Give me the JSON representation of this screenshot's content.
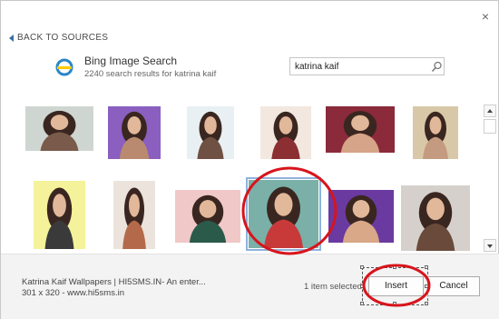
{
  "dialog": {
    "close_glyph": "×",
    "back_label": "BACK TO SOURCES",
    "source": {
      "name": "Bing Image Search",
      "results_text": "2240 search results for katrina kaif"
    },
    "search": {
      "value": "katrina kaif",
      "icon": "magnifier-icon"
    }
  },
  "thumbnails": [
    {
      "row": 1,
      "col": 1,
      "selected": false,
      "bg": "#cfd6d2",
      "tone": "#7a5a4a"
    },
    {
      "row": 1,
      "col": 2,
      "selected": false,
      "bg": "#8a5fc0",
      "tone": "#b98a70"
    },
    {
      "row": 1,
      "col": 3,
      "selected": false,
      "bg": "#e9f0f3",
      "tone": "#6f5143"
    },
    {
      "row": 1,
      "col": 4,
      "selected": false,
      "bg": "#f2e8e0",
      "tone": "#8c2f33"
    },
    {
      "row": 1,
      "col": 5,
      "selected": false,
      "bg": "#8a2a3a",
      "tone": "#d6a488"
    },
    {
      "row": 1,
      "col": 6,
      "selected": false,
      "bg": "#d8c8a8",
      "tone": "#c49a80"
    },
    {
      "row": 2,
      "col": 1,
      "selected": false,
      "bg": "#f4f29a",
      "tone": "#3a3a3a"
    },
    {
      "row": 2,
      "col": 2,
      "selected": false,
      "bg": "#ece4dc",
      "tone": "#b46a4a"
    },
    {
      "row": 2,
      "col": 3,
      "selected": false,
      "bg": "#f0c8c8",
      "tone": "#2a5a4a"
    },
    {
      "row": 2,
      "col": 4,
      "selected": true,
      "bg": "#7ab0a8",
      "tone": "#c83a3a"
    },
    {
      "row": 2,
      "col": 5,
      "selected": false,
      "bg": "#6a3aa0",
      "tone": "#d8a888"
    },
    {
      "row": 2,
      "col": 6,
      "selected": false,
      "bg": "#d6d0cc",
      "tone": "#6a4a3a"
    }
  ],
  "footer": {
    "image_title": "Katrina Kaif Wallpapers | HI5SMS.IN- An enter...",
    "image_meta": "301 x 320 - www.hi5sms.in",
    "selection_status": "1 item selected",
    "insert_label": "Insert",
    "cancel_label": "Cancel"
  },
  "annotations": {
    "highlight_color": "#d8141c"
  }
}
